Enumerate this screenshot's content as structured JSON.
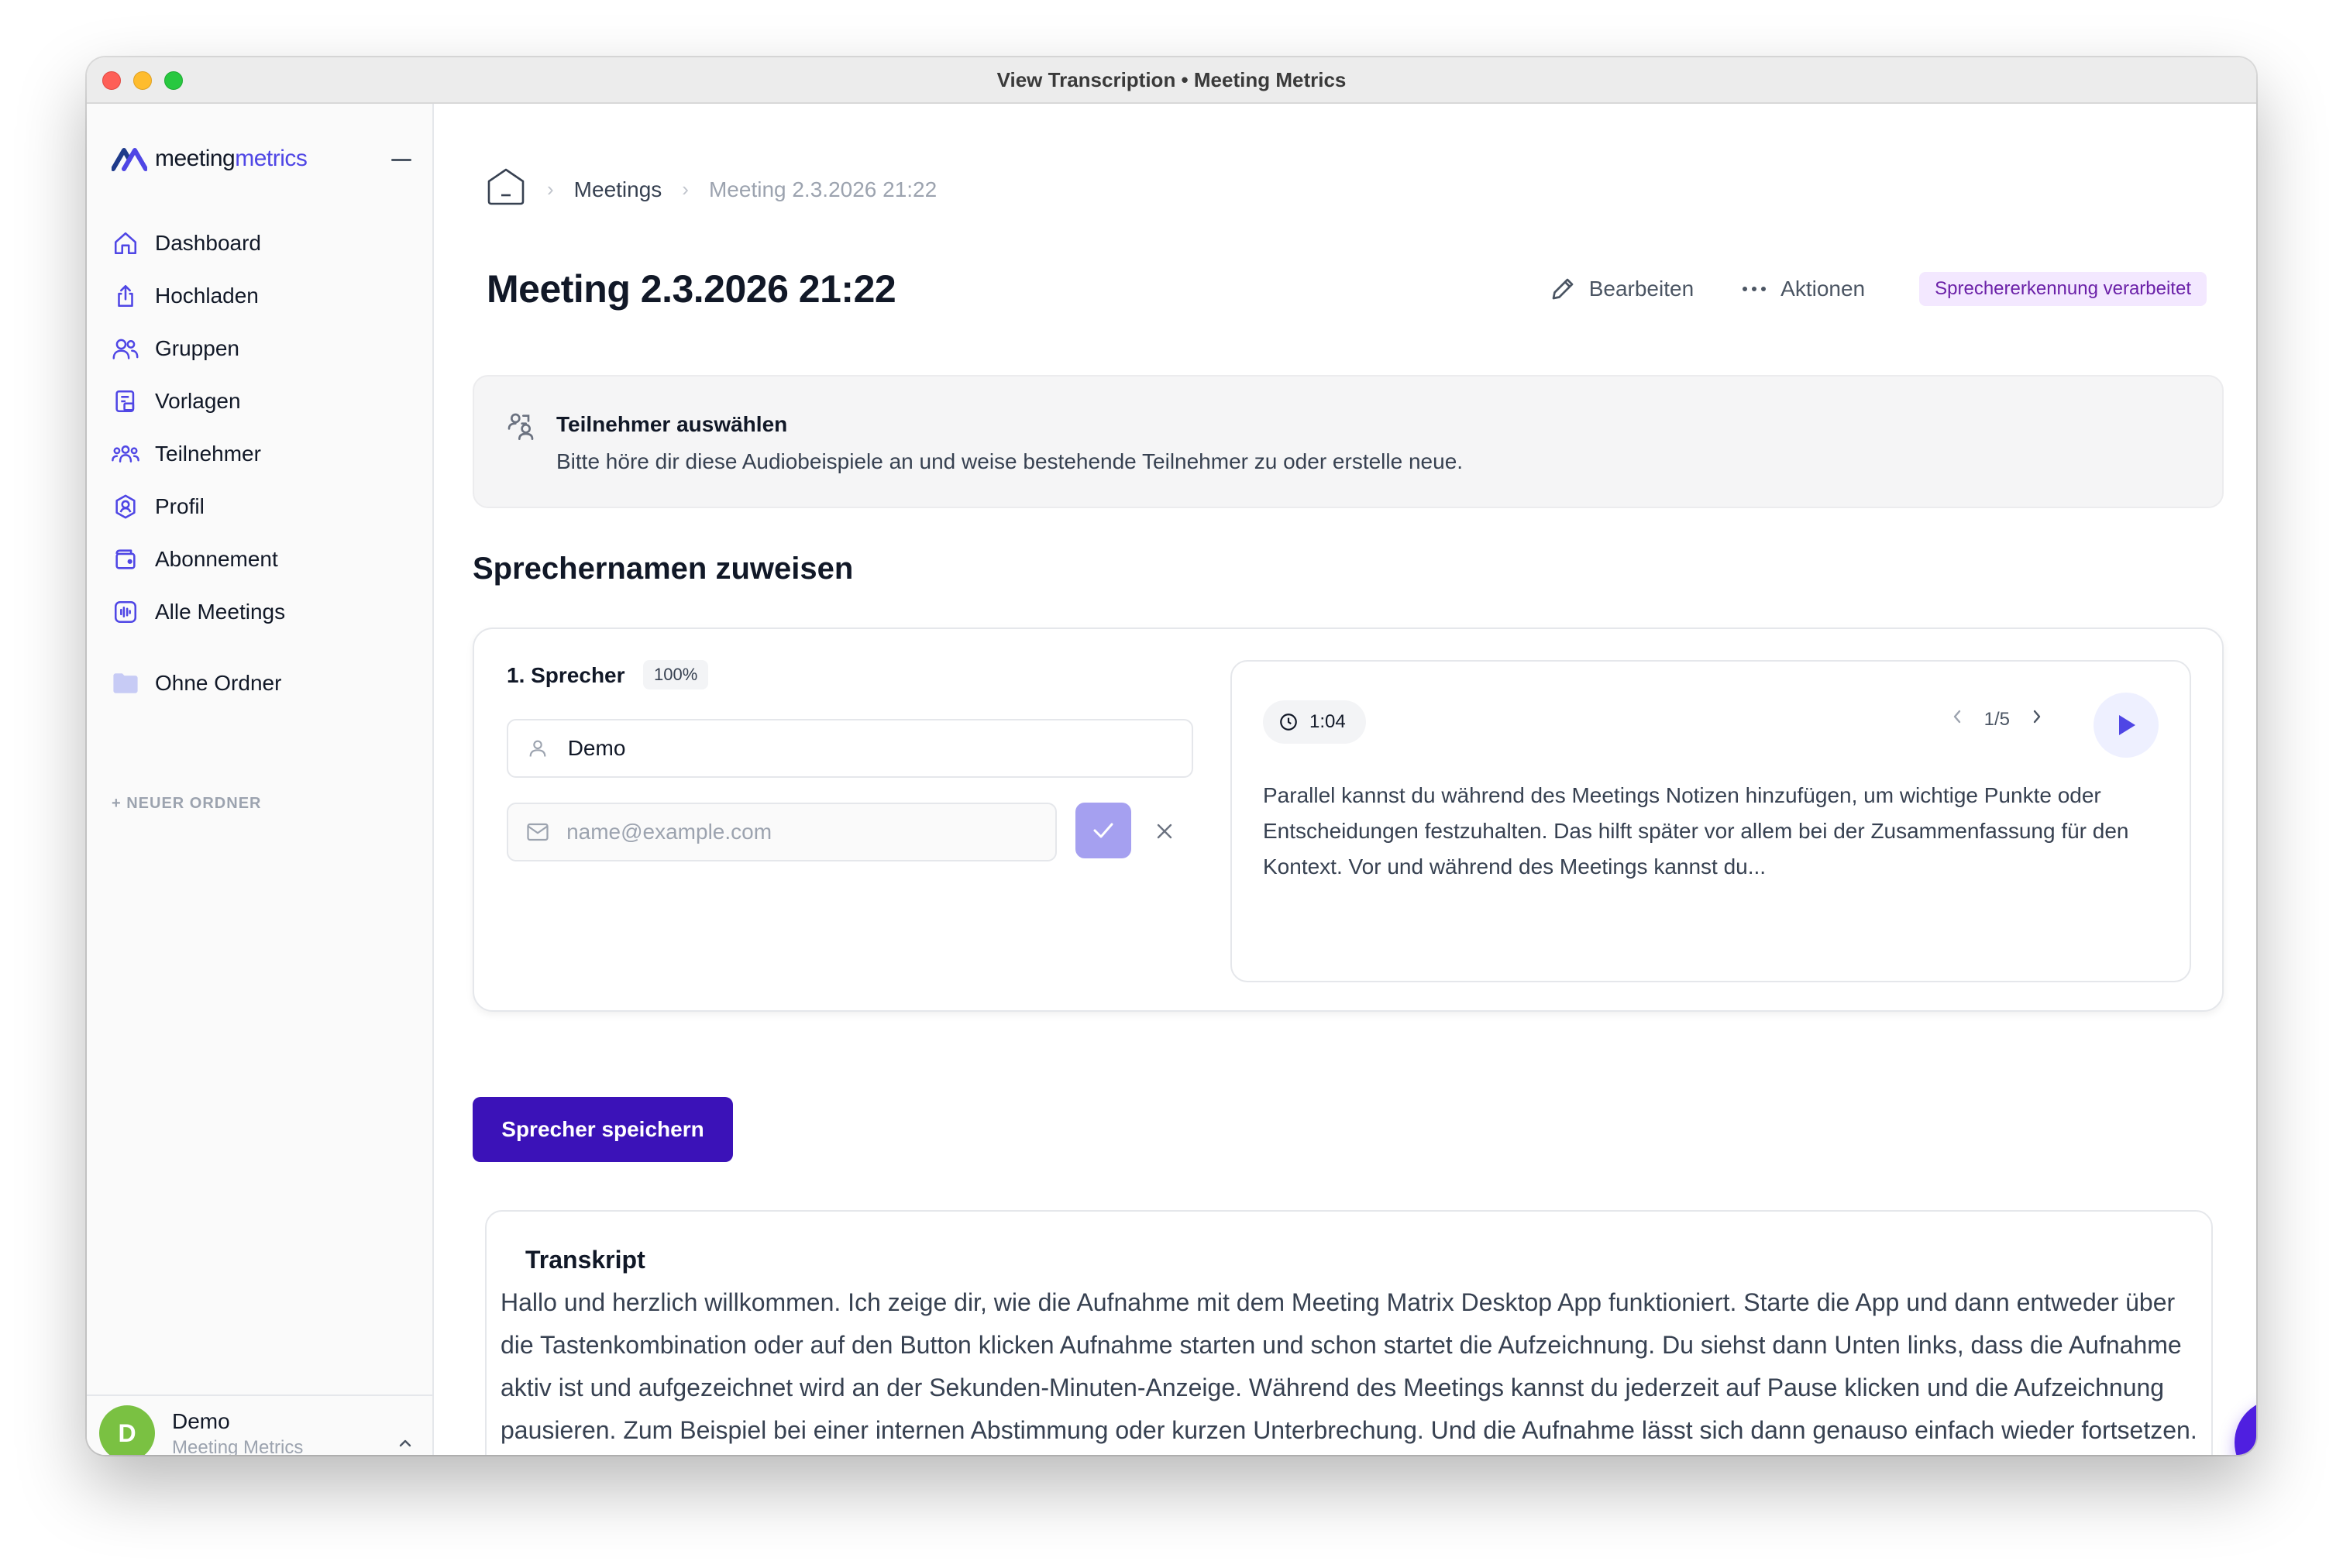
{
  "window": {
    "title": "View Transcription • Meeting Metrics"
  },
  "brand": {
    "name_part1": "meeting",
    "name_part2": "metrics",
    "accent": "#4f46e5"
  },
  "sidebar": {
    "items": [
      {
        "label": "Dashboard",
        "icon": "home-icon"
      },
      {
        "label": "Hochladen",
        "icon": "upload-icon"
      },
      {
        "label": "Gruppen",
        "icon": "users-icon"
      },
      {
        "label": "Vorlagen",
        "icon": "template-icon"
      },
      {
        "label": "Teilnehmer",
        "icon": "participants-icon"
      },
      {
        "label": "Profil",
        "icon": "profile-icon"
      },
      {
        "label": "Abonnement",
        "icon": "wallet-icon"
      },
      {
        "label": "Alle Meetings",
        "icon": "audio-wave-icon"
      }
    ],
    "folder": {
      "label": "Ohne Ordner",
      "icon": "folder-icon"
    },
    "new_folder": "+ NEUER ORDNER"
  },
  "user": {
    "initial": "D",
    "name": "Demo",
    "org": "Meeting Metrics"
  },
  "breadcrumb": {
    "meetings": "Meetings",
    "current": "Meeting 2.3.2026 21:22"
  },
  "page": {
    "title": "Meeting 2.3.2026 21:22",
    "edit_label": "Bearbeiten",
    "actions_label": "Aktionen",
    "status": "Sprechererkennung verarbeitet"
  },
  "info": {
    "title": "Teilnehmer auswählen",
    "text": "Bitte höre dir diese Audiobeispiele an und weise bestehende Teilnehmer zu oder erstelle neue."
  },
  "assign": {
    "section_title": "Sprechernamen zuweisen",
    "speaker_label": "1. Sprecher",
    "confidence": "100%",
    "name_value": "Demo",
    "email_placeholder": "name@example.com",
    "sample": {
      "time": "1:04",
      "pager": "1/5",
      "text": "Parallel kannst du während des Meetings Notizen hinzufügen, um wichtige Punkte oder Entscheidungen festzuhalten. Das hilft später vor allem bei der Zusammenfassung für den Kontext. Vor und während des Meetings kannst du..."
    },
    "save_label": "Sprecher speichern"
  },
  "transcript": {
    "title": "Transkript",
    "text": "Hallo und herzlich willkommen. Ich zeige dir, wie die Aufnahme mit dem Meeting Matrix Desktop App funktioniert. Starte die App und dann entweder über die Tastenkombination oder auf den Button klicken Aufnahme starten und schon startet die Aufzeichnung. Du siehst dann Unten links, dass die Aufnahme aktiv ist und aufgezeichnet wird an der Sekunden-Minuten-Anzeige. Während des Meetings kannst du jederzeit auf Pause klicken und die Aufzeichnung pausieren. Zum Beispiel bei einer internen Abstimmung oder kurzen Unterbrechung. Und die Aufnahme lässt sich dann genauso einfach wieder fortsetzen. Parallel kannst du während des Meetings Notizen hinzufügen, um wichtige Punkte oder Entscheidungen festzuhalten. Das hilft später vor allem bei der Zusammenfassung für den Kontext. Vor und während des"
  },
  "colors": {
    "primary_button": "#3b12b8",
    "badge_bg": "#f3e8ff",
    "badge_text": "#6b21a8",
    "avatar": "#7ac142",
    "chat_fab": "#4f1fe0"
  }
}
